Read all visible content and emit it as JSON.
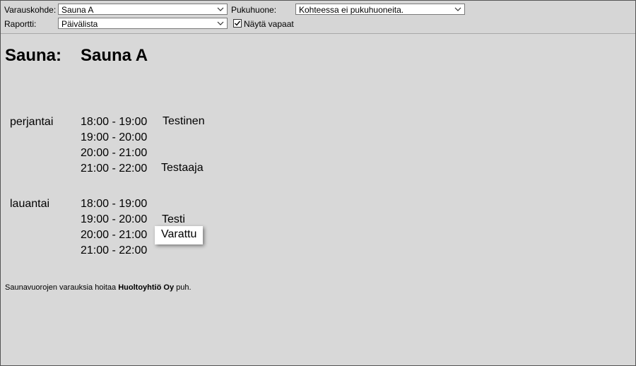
{
  "toolbar": {
    "varauskohde_label": "Varauskohde:",
    "varauskohde_value": "Sauna A",
    "pukuhuone_label": "Pukuhuone:",
    "pukuhuone_value": "Kohteessa ei pukuhuoneita.",
    "raportti_label": "Raportti:",
    "raportti_value": "Päivälista",
    "nayta_vapaat_label": "Näytä vapaat",
    "nayta_vapaat_checked": true
  },
  "heading": {
    "label": "Sauna:",
    "value": "Sauna A"
  },
  "days": [
    {
      "day": "perjantai",
      "slots": [
        {
          "time": "18:00 - 19:00",
          "name": "Testinen"
        },
        {
          "time": "19:00 - 20:00",
          "name": ""
        },
        {
          "time": "20:00 - 21:00",
          "name": ""
        },
        {
          "time": "21:00 - 22:00",
          "name": "Testaaja"
        }
      ]
    },
    {
      "day": "lauantai",
      "slots": [
        {
          "time": "18:00 - 19:00",
          "name": ""
        },
        {
          "time": "19:00 - 20:00",
          "name": "Testi"
        },
        {
          "time": "20:00 - 21:00",
          "name": ""
        },
        {
          "time": "21:00 - 22:00",
          "name": ""
        }
      ]
    }
  ],
  "popup": {
    "text": "Varattu"
  },
  "footer": {
    "prefix": "Saunavuorojen varauksia hoitaa ",
    "company": "Huoltoyhtiö Oy",
    "suffix": " puh."
  }
}
